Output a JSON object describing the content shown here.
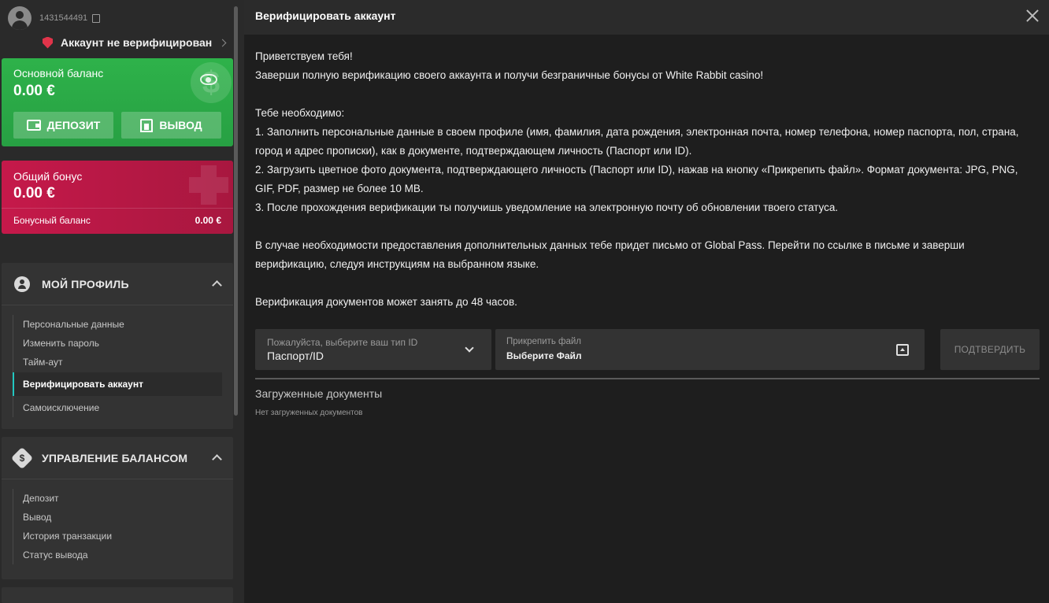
{
  "user": {
    "id": "1431544491",
    "verify_status": "Аккаунт не верифицирован"
  },
  "balance": {
    "label": "Основной баланс",
    "amount": "0.00 €",
    "deposit": "ДЕПОЗИТ",
    "withdraw": "ВЫВОД"
  },
  "bonus": {
    "label": "Общий бонус",
    "amount": "0.00 €",
    "sub_label": "Бонусный баланс",
    "sub_amount": "0.00 €"
  },
  "profile_menu": {
    "title": "МОЙ ПРОФИЛЬ",
    "items": [
      {
        "label": "Персональные данные"
      },
      {
        "label": "Изменить пароль"
      },
      {
        "label": "Тайм-аут"
      },
      {
        "label": "Верифицировать аккаунт"
      },
      {
        "label": "Самоисключение"
      }
    ]
  },
  "balance_menu": {
    "title": "УПРАВЛЕНИЕ БАЛАНСОМ",
    "items": [
      {
        "label": "Депозит"
      },
      {
        "label": "Вывод"
      },
      {
        "label": "История транзакции"
      },
      {
        "label": "Статус вывода"
      }
    ]
  },
  "page": {
    "title": "Верифицировать аккаунт",
    "greeting": "Приветствуем тебя!",
    "intro": "Заверши полную верификацию своего аккаунта и получи безграничные бонусы от White Rabbit casino!",
    "need": "Тебе необходимо:",
    "step1": "1. Заполнить персональные данные в своем профиле (имя, фамилия, дата рождения, электронная почта, номер телефона, номер паспорта, пол, страна, город и адрес прописки), как в документе, подтверждающем личность (Паспорт или ID).",
    "step2": "2. Загрузить цветное фото документа, подтверждающего личность (Паспорт или ID), нажав на кнопку «Прикрепить файл». Формат документа: JPG, PNG, GIF, PDF, размер не более 10 MB.",
    "step3": "3. После прохождения верификации ты получишь уведомление на электронную почту об обновлении твоего статуса.",
    "extra": "В случае необходимости предоставления дополнительных данных тебе придет письмо от Global Pass. Перейти по ссылке в письме и заверши верификацию, следуя инструкциям на выбранном языке.",
    "duration": "Верификация документов может занять до 48 часов."
  },
  "form": {
    "id_type_label": "Пожалуйста, выберите ваш тип ID",
    "id_type_value": "Паспорт/ID",
    "file_label": "Прикрепить файл",
    "file_value": "Выберите Файл",
    "confirm": "ПОДТВЕРДИТЬ"
  },
  "uploaded": {
    "title": "Загруженные документы",
    "empty": "Нет загруженных документов"
  },
  "colors": {
    "accent_green": "#2eb24a",
    "accent_bonus": "#c5194a",
    "active_marker": "#22c7c0",
    "warning": "#e0344a"
  }
}
